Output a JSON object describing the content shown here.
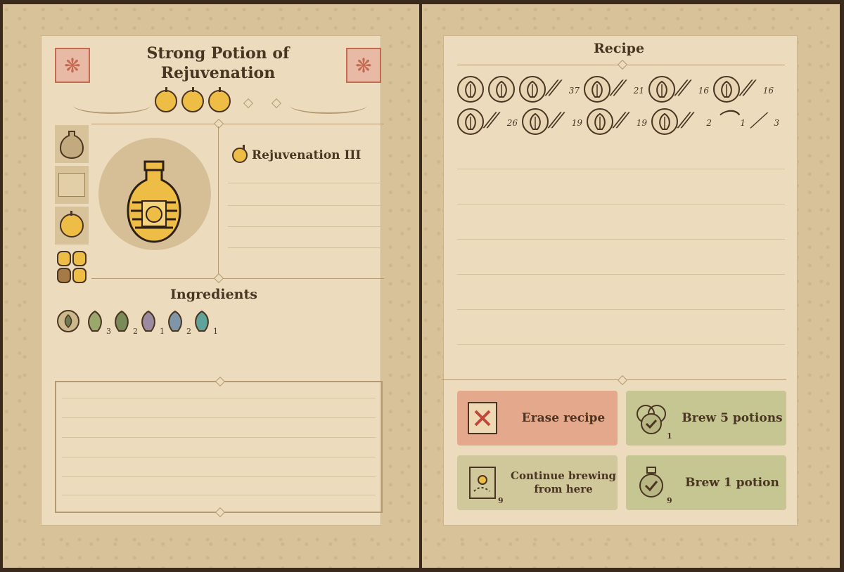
{
  "left_page": {
    "title": "Strong Potion of Rejuvenation",
    "effect_label": "Rejuvenation III",
    "ingredients_heading": "Ingredients",
    "ingredients": [
      {
        "icon": "base-water-icon",
        "count": ""
      },
      {
        "icon": "herb-green-icon",
        "count": "3"
      },
      {
        "icon": "herb-dark-icon",
        "count": "2"
      },
      {
        "icon": "leaf-purple-icon",
        "count": "1"
      },
      {
        "icon": "leaf-blue-icon",
        "count": "2"
      },
      {
        "icon": "flower-teal-icon",
        "count": "1"
      }
    ]
  },
  "right_page": {
    "recipe_heading": "Recipe",
    "recipe_row1": [
      {
        "type": "icon",
        "icon": "base-icon"
      },
      {
        "type": "icon",
        "icon": "herb-icon"
      },
      {
        "type": "icon",
        "icon": "herb-icon"
      },
      {
        "type": "grind",
        "count": "37"
      },
      {
        "type": "icon",
        "icon": "herb-icon"
      },
      {
        "type": "grind",
        "count": "21"
      },
      {
        "type": "icon",
        "icon": "herb-icon"
      },
      {
        "type": "grind",
        "count": "16"
      },
      {
        "type": "icon",
        "icon": "herb-icon"
      },
      {
        "type": "grind",
        "count": "16"
      }
    ],
    "recipe_row2": [
      {
        "type": "icon",
        "icon": "leaf-icon"
      },
      {
        "type": "grind",
        "count": "26"
      },
      {
        "type": "icon",
        "icon": "leaf-icon"
      },
      {
        "type": "grind",
        "count": "19"
      },
      {
        "type": "icon",
        "icon": "leaf-icon"
      },
      {
        "type": "grind",
        "count": "19"
      },
      {
        "type": "icon",
        "icon": "flower-icon"
      },
      {
        "type": "grind",
        "count": "2"
      },
      {
        "type": "ladle",
        "count": "1"
      },
      {
        "type": "bellows",
        "count": "3"
      }
    ],
    "buttons": {
      "erase": "Erase recipe",
      "brew5": "Brew 5 potions",
      "brew5_count": "1",
      "continue": "Continue brewing from here",
      "continue_count": "9",
      "brew1": "Brew 1 potion",
      "brew1_count": "9"
    }
  },
  "colors": {
    "erase_bg": "#e4a88c",
    "brew_bg": "#c6c693",
    "continue_bg": "#d0c79a",
    "apple": "#eebd45",
    "ink": "#4a3422"
  }
}
